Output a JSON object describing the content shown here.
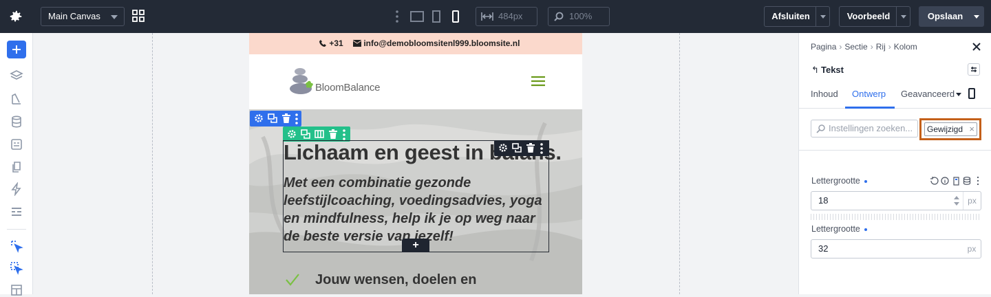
{
  "topbar": {
    "canvas_select": "Main Canvas",
    "width_value": "484px",
    "zoom_value": "100%",
    "close_label": "Afsluiten",
    "preview_label": "Voorbeeld",
    "save_label": "Opslaan",
    "icons": [
      "gear-icon",
      "grid-icon",
      "kebab-icon",
      "desktop-icon",
      "tablet-icon",
      "mobile-icon",
      "width-arrows-icon",
      "zoom-icon"
    ]
  },
  "leftbar": {
    "icons": [
      "add-icon",
      "layers-icon",
      "styles-icon",
      "database-icon",
      "forms-icon",
      "pages-icon",
      "lightning-icon",
      "sections-icon",
      "select-icon",
      "multi-select-icon",
      "layout-icon"
    ]
  },
  "site": {
    "phone": "+31",
    "email": "info@demobloomsitenl999.bloomsite.nl",
    "logo_text": "BloomBalance",
    "hero_title": "Lichaam en geest in balans.",
    "hero_subtitle": "Met een combinatie gezonde leefstijlcoaching, voedingsadvies, yoga en mindfulness, help ik je op weg naar de beste versie van jezelf!",
    "check_item": "Jouw wensen, doelen en",
    "add_symbol": "+"
  },
  "panel": {
    "breadcrumb": [
      "Pagina",
      "Sectie",
      "Rij",
      "Kolom"
    ],
    "breadcrumb_sep": "›",
    "element_title": "Tekst",
    "element_back": "↰",
    "tabs": [
      "Inhoud",
      "Ontwerp",
      "Geavanceerd"
    ],
    "active_tab": "Ontwerp",
    "search_placeholder": "Instellingen zoeken...",
    "filter_chip": "Gewijzigd",
    "filter_chip_close": "×",
    "fields": [
      {
        "label": "Lettergrootte",
        "value": "18",
        "unit": "px"
      },
      {
        "label": "Lettergrootte",
        "value": "32",
        "unit": "px"
      }
    ]
  },
  "colors": {
    "topbar": "#232a36",
    "accent": "#2f6fec",
    "row_toolbar": "#23c08a",
    "highlight": "#c4601a",
    "top_strip": "#fbd9cc"
  }
}
